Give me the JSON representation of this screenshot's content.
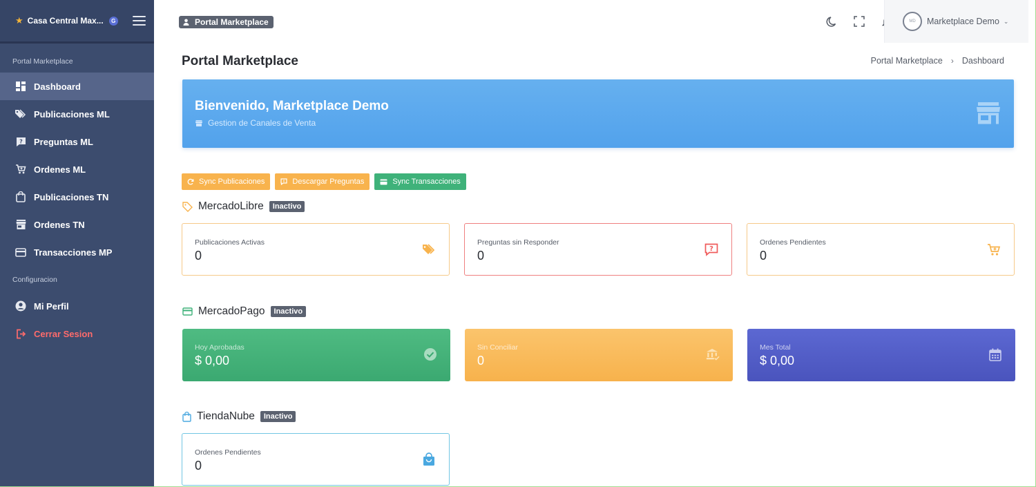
{
  "sidebar": {
    "brand": "Casa Central Max...",
    "brand_badge": "G",
    "sections": {
      "portal": "Portal Marketplace",
      "config": "Configuracion"
    },
    "items": [
      {
        "label": "Dashboard",
        "icon": "dashboard-icon"
      },
      {
        "label": "Publicaciones ML",
        "icon": "tags-icon"
      },
      {
        "label": "Preguntas ML",
        "icon": "question-icon"
      },
      {
        "label": "Ordenes ML",
        "icon": "cart-icon"
      },
      {
        "label": "Publicaciones TN",
        "icon": "bag-icon"
      },
      {
        "label": "Ordenes TN",
        "icon": "store-icon"
      },
      {
        "label": "Transacciones MP",
        "icon": "card-icon"
      },
      {
        "label": "Mi Perfil",
        "icon": "user-circle-icon"
      },
      {
        "label": "Cerrar Sesion",
        "icon": "logout-icon"
      }
    ]
  },
  "topbar": {
    "chip": "Portal Marketplace",
    "user": "Marketplace Demo",
    "avatar_text": "MD"
  },
  "page": {
    "title": "Portal Marketplace",
    "breadcrumb": [
      "Portal Marketplace",
      "Dashboard"
    ]
  },
  "banner": {
    "title": "Bienvenido, Marketplace Demo",
    "subtitle": "Gestion de Canales de Venta"
  },
  "actions": {
    "sync_pub": "Sync Publicaciones",
    "descargar": "Descargar Preguntas",
    "sync_tx": "Sync Transacciones"
  },
  "mercadolibre": {
    "title": "MercadoLibre",
    "status": "Inactivo",
    "cards": [
      {
        "label": "Publicaciones Activas",
        "value": "0"
      },
      {
        "label": "Preguntas sin Responder",
        "value": "0"
      },
      {
        "label": "Ordenes Pendientes",
        "value": "0"
      }
    ]
  },
  "mercadopago": {
    "title": "MercadoPago",
    "status": "Inactivo",
    "cards": [
      {
        "label": "Hoy Aprobadas",
        "value": "$ 0,00"
      },
      {
        "label": "Sin Conciliar",
        "value": "0"
      },
      {
        "label": "Mes Total",
        "value": "$ 0,00"
      }
    ]
  },
  "tiendanube": {
    "title": "TiendaNube",
    "status": "Inactivo",
    "cards": [
      {
        "label": "Ordenes Pendientes",
        "value": "0"
      }
    ]
  },
  "colors": {
    "sidebar": "#3c4c6e",
    "banner": "#5aa8ee",
    "orange": "#f8b34d",
    "green": "#3fb27a",
    "purple": "#5059c6",
    "danger": "#ff6b6b"
  }
}
